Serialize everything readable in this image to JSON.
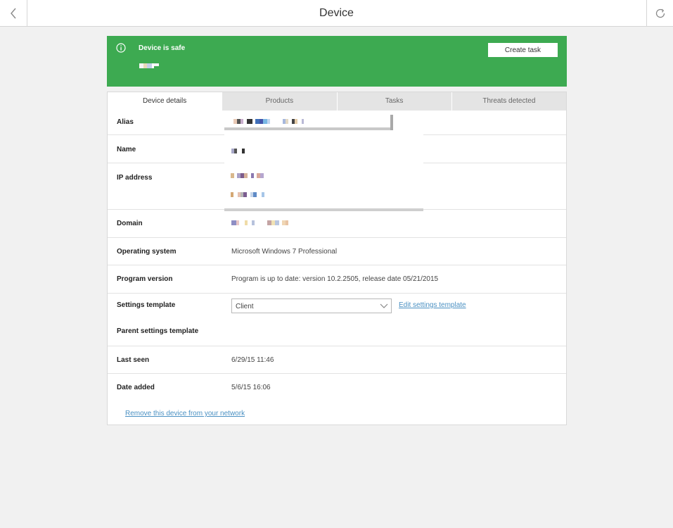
{
  "header": {
    "title": "Device",
    "back_icon": "chevron-left-icon",
    "refresh_icon": "refresh-icon"
  },
  "banner": {
    "status": "Device is safe",
    "create_task_label": "Create task",
    "color": "#3daa51"
  },
  "tabs": [
    {
      "label": "Device details",
      "active": true
    },
    {
      "label": "Products",
      "active": false
    },
    {
      "label": "Tasks",
      "active": false
    },
    {
      "label": "Threats detected",
      "active": false
    }
  ],
  "details": {
    "alias_label": "Alias",
    "name_label": "Name",
    "ip_label": "IP address",
    "domain_label": "Domain",
    "os_label": "Operating system",
    "os_value": "Microsoft Windows 7 Professional",
    "program_label": "Program version",
    "program_value": "Program is up to date: version 10.2.2505, release date 05/21/2015",
    "settings_label": "Settings template",
    "settings_value": "Client",
    "edit_settings_link": "Edit settings template",
    "parent_settings_label": "Parent settings template",
    "last_seen_label": "Last seen",
    "last_seen_value": "6/29/15 11:46",
    "date_added_label": "Date added",
    "date_added_value": "5/6/15 16:06"
  },
  "remove_link": "Remove this device from your network",
  "colors": {
    "accent": "#3daa51",
    "link": "#4a90c2"
  }
}
